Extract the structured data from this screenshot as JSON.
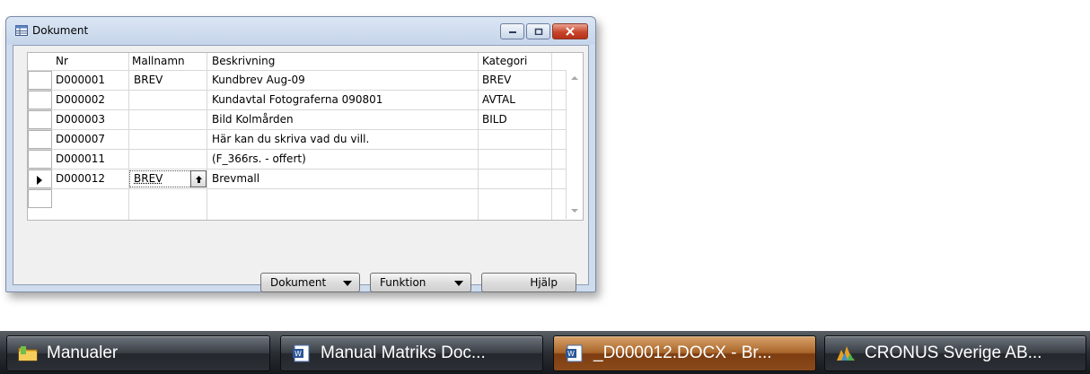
{
  "window": {
    "title": "Dokument",
    "controls": [
      "minimize",
      "maximize",
      "close"
    ]
  },
  "grid": {
    "columns": [
      "Nr",
      "Mallnamn",
      "Beskrivning",
      "Kategori"
    ],
    "rows": [
      {
        "nr": "D000001",
        "mallnamn": "BREV",
        "beskrivning": "Kundbrev Aug-09",
        "kategori": "BREV"
      },
      {
        "nr": "D000002",
        "mallnamn": "",
        "beskrivning": "Kundavtal Fotograferna 090801",
        "kategori": "AVTAL"
      },
      {
        "nr": "D000003",
        "mallnamn": "",
        "beskrivning": "Bild Kolmården",
        "kategori": "BILD"
      },
      {
        "nr": "D000007",
        "mallnamn": "",
        "beskrivning": "Här kan du skriva vad du vill.",
        "kategori": ""
      },
      {
        "nr": "D000011",
        "mallnamn": "",
        "beskrivning": "(F_366rs. - offert)",
        "kategori": ""
      },
      {
        "nr": "D000012",
        "mallnamn": "BREV",
        "beskrivning": "Brevmall",
        "kategori": ""
      },
      {
        "nr": "",
        "mallnamn": "",
        "beskrivning": "",
        "kategori": ""
      }
    ],
    "selected_row": 5
  },
  "buttons": {
    "dokument": "Dokument",
    "funktion": "Funktion",
    "hjalp": "Hjälp"
  },
  "taskbar": {
    "items": [
      {
        "label": "Manualer",
        "icon": "folder-icon",
        "active": false
      },
      {
        "label": "Manual Matriks Doc...",
        "icon": "word-doc-icon",
        "active": false
      },
      {
        "label": "_D000012.DOCX - Br...",
        "icon": "word-doc-icon",
        "active": true
      },
      {
        "label": "CRONUS Sverige AB...",
        "icon": "navision-icon",
        "active": false
      }
    ]
  }
}
